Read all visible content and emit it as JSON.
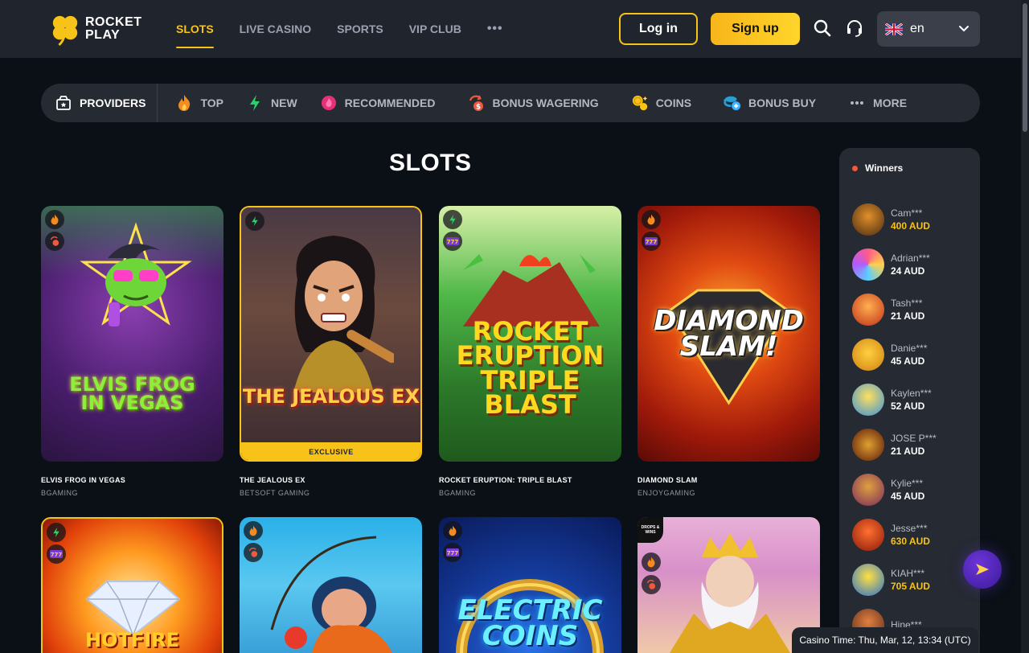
{
  "header": {
    "logo_text": "ROCKET\nPLAY",
    "nav": [
      "SLOTS",
      "LIVE CASINO",
      "SPORTS",
      "VIP CLUB"
    ],
    "nav_more": "•••",
    "login_label": "Log in",
    "signup_label": "Sign up",
    "language": "en",
    "accent_color": "#f7c318"
  },
  "filters": {
    "providers": "PROVIDERS",
    "items": [
      "TOP",
      "NEW",
      "RECOMMENDED",
      "BONUS WAGERING",
      "COINS",
      "BONUS BUY",
      "MORE"
    ]
  },
  "page_title": "SLOTS",
  "games": [
    {
      "name": "ELVIS FROG IN VEGAS",
      "provider": "BGAMING",
      "art": "ELVIS FROG\nIN VEGAS"
    },
    {
      "name": "THE JEALOUS EX",
      "provider": "BETSOFT GAMING",
      "art": "THE JEALOUS EX",
      "ribbon": "EXCLUSIVE"
    },
    {
      "name": "ROCKET ERUPTION: TRIPLE BLAST",
      "provider": "BGAMING",
      "art": "ROCKET\nERUPTION\nTRIPLE BLAST"
    },
    {
      "name": "DIAMOND SLAM",
      "provider": "ENJOYGAMING",
      "art": "DIAMOND\nSLAM!"
    },
    {
      "name": "",
      "provider": "",
      "art": "HOTFIRE"
    },
    {
      "name": "",
      "provider": "",
      "art": ""
    },
    {
      "name": "",
      "provider": "",
      "art": "ELECTRIC\nCOINS"
    },
    {
      "name": "",
      "provider": "",
      "art": "",
      "badge_text": "DROPS & WINS"
    }
  ],
  "winners": {
    "title": "Winners",
    "list": [
      {
        "name": "Cam***",
        "amount": "400 AUD"
      },
      {
        "name": "Adrian***",
        "amount": "24 AUD"
      },
      {
        "name": "Tash***",
        "amount": "21 AUD"
      },
      {
        "name": "Danie***",
        "amount": "45 AUD"
      },
      {
        "name": "Kaylen***",
        "amount": "52 AUD"
      },
      {
        "name": "JOSE P***",
        "amount": "21 AUD"
      },
      {
        "name": "Kylie***",
        "amount": "45 AUD"
      },
      {
        "name": "Jesse***",
        "amount": "630 AUD"
      },
      {
        "name": "KIAH***",
        "amount": "705 AUD"
      },
      {
        "name": "Hine***",
        "amount": ""
      }
    ]
  },
  "casino_time": "Casino Time: Thu, Mar, 12, 13:34 (UTC)"
}
